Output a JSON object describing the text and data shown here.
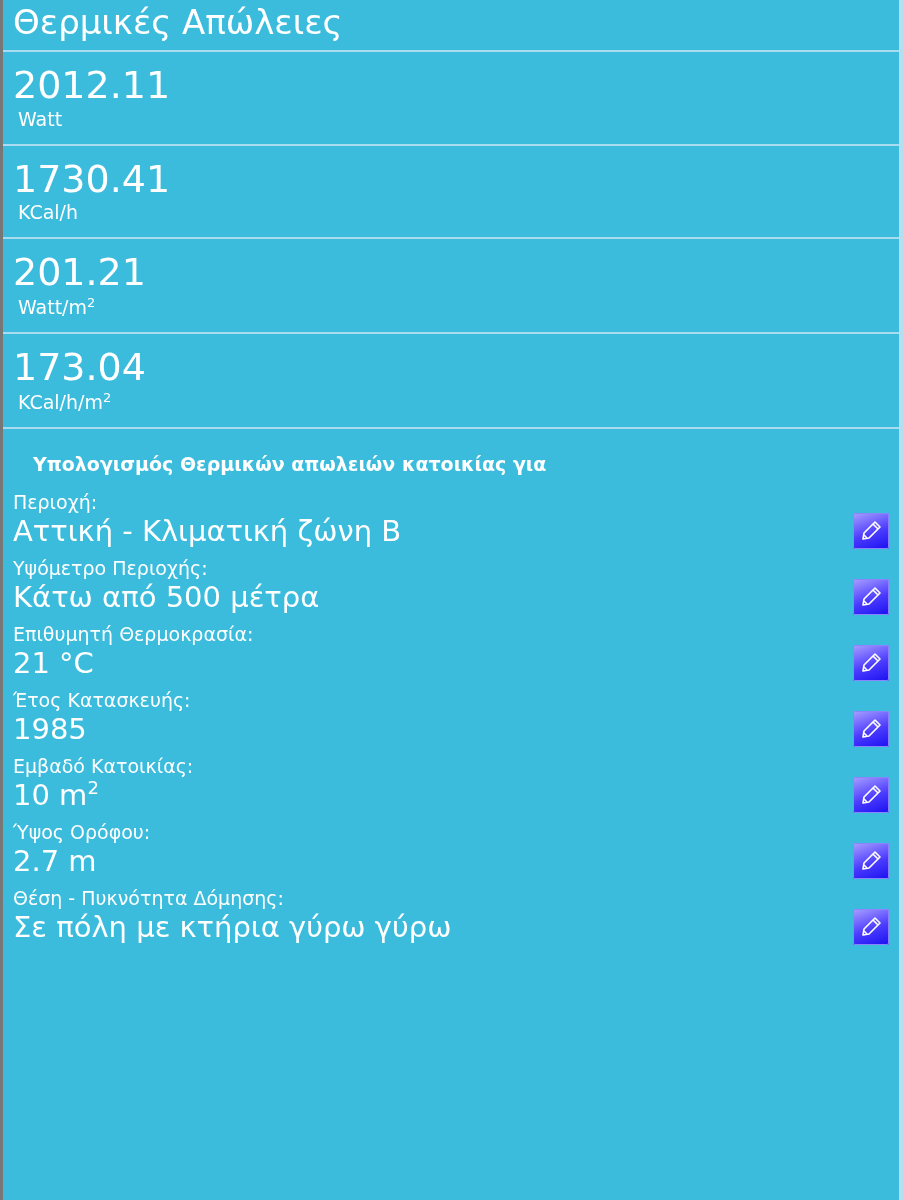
{
  "title": "Θερμικές Απώλειες",
  "results": [
    {
      "value": "2012.11",
      "unit": "Watt"
    },
    {
      "value": "1730.41",
      "unit": "KCal/h"
    },
    {
      "value": "201.21",
      "unit": "Watt/m$^{2}$"
    },
    {
      "value": "173.04",
      "unit": "KCal/h/m$^{2}$"
    }
  ],
  "parameters_heading": "Υπολογισμός Θερμικών απωλειών κατοικίας για",
  "parameters": [
    {
      "label": "Περιοχή:",
      "value": "Αττική - Κλιματική ζώνη Β"
    },
    {
      "label": "Υψόμετρο Περιοχής:",
      "value": "Κάτω από 500 μέτρα"
    },
    {
      "label": "Επιθυμητή Θερμοκρασία:",
      "value": "21 °C"
    },
    {
      "label": "Έτος Κατασκευής:",
      "value": "1985"
    },
    {
      "label": "Εμβαδό Κατοικίας:",
      "value": "10 m$^{2}$"
    },
    {
      "label": "Ύψος Ορόφου:",
      "value": "2.7 m"
    },
    {
      "label": "Θέση - Πυκνότητα Δόμησης:",
      "value": "Σε πόλη με κτήρια γύρω γύρω"
    }
  ]
}
